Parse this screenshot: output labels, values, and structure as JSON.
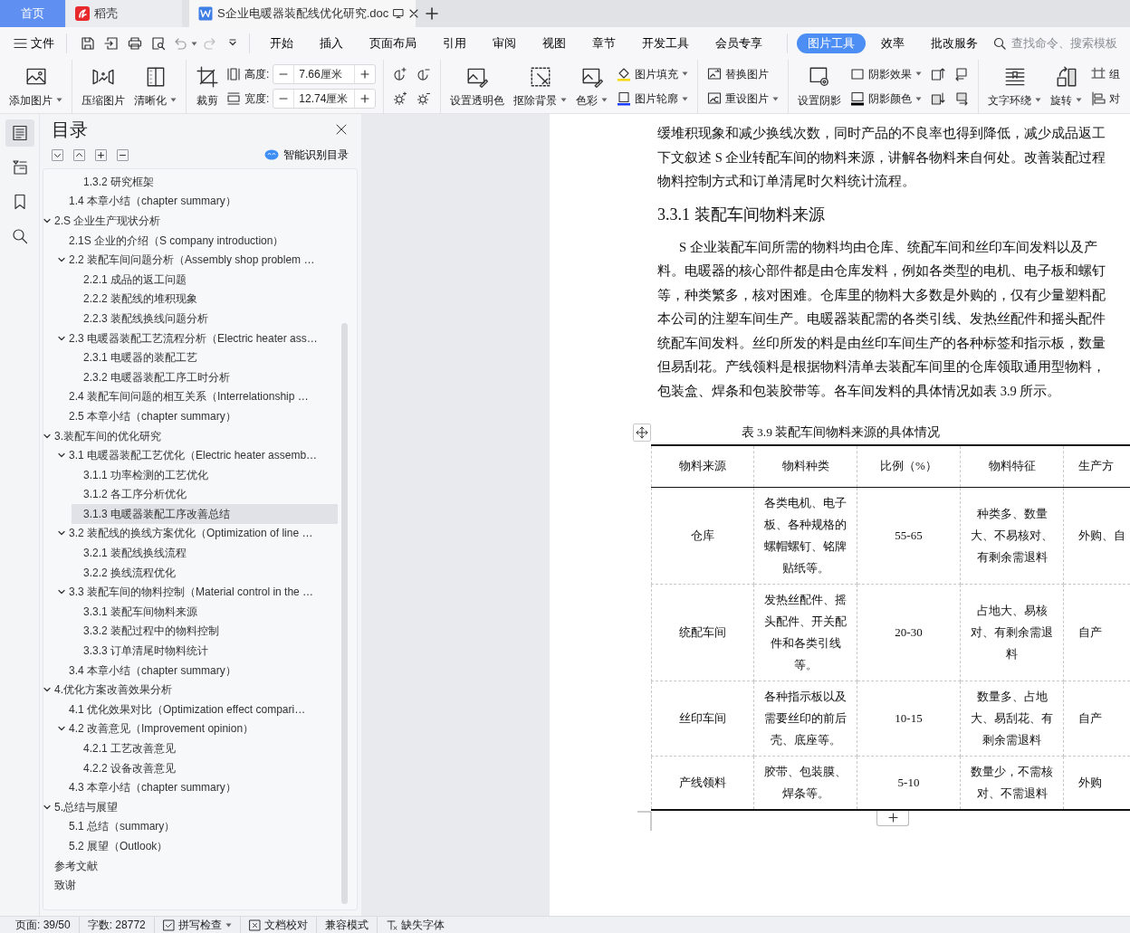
{
  "tabs": [
    {
      "label": "首页",
      "kind": "home",
      "selected": false
    },
    {
      "label": "稻壳",
      "kind": "app",
      "selected": false
    },
    {
      "label": "S企业电暖器装配线优化研究.doc",
      "kind": "document",
      "selected": true
    }
  ],
  "menu": {
    "file": "文件",
    "tabs": [
      {
        "label": "开始",
        "selected": false
      },
      {
        "label": "插入",
        "selected": false
      },
      {
        "label": "页面布局",
        "selected": false
      },
      {
        "label": "引用",
        "selected": false
      },
      {
        "label": "审阅",
        "selected": false
      },
      {
        "label": "视图",
        "selected": false
      },
      {
        "label": "章节",
        "selected": false
      },
      {
        "label": "开发工具",
        "selected": false
      },
      {
        "label": "会员专享",
        "selected": false
      },
      {
        "label": "图片工具",
        "selected": true
      },
      {
        "label": "效率",
        "selected": false
      },
      {
        "label": "批改服务",
        "selected": false
      }
    ],
    "search": {
      "placeholder": "查找命令、搜索模板"
    }
  },
  "ribbon": {
    "groups": [
      {
        "columns": [
          [
            {
              "kind": "large",
              "label": "添加图片",
              "dropdown": true
            }
          ]
        ]
      },
      {
        "columns": [
          [
            {
              "kind": "large",
              "label": "压缩图片",
              "dropdown": false
            }
          ],
          [
            {
              "kind": "large",
              "label": "清晰化",
              "dropdown": true
            }
          ]
        ]
      },
      {
        "columns": [
          [
            {
              "kind": "large",
              "label": "裁剪",
              "dropdown": false
            }
          ],
          [
            {
              "kind": "spin",
              "label": "高度:",
              "value": "7.66厘米"
            },
            {
              "kind": "spin",
              "label": "宽度:",
              "value": "12.74厘米"
            }
          ]
        ]
      },
      {
        "columns": [
          [
            {
              "kind": "icon"
            },
            {
              "kind": "icon"
            }
          ],
          [
            {
              "kind": "icon"
            },
            {
              "kind": "icon"
            }
          ]
        ]
      },
      {
        "columns": [
          [
            {
              "kind": "large",
              "label": "设置透明色",
              "dropdown": false
            }
          ],
          [
            {
              "kind": "large",
              "label": "抠除背景",
              "dropdown": true
            }
          ],
          [
            {
              "kind": "large",
              "label": "色彩",
              "dropdown": true
            }
          ],
          [
            {
              "kind": "small",
              "label": "图片填充",
              "dropdown": true
            },
            {
              "kind": "small",
              "label": "图片轮廓",
              "dropdown": true
            }
          ]
        ]
      },
      {
        "columns": [
          [
            {
              "kind": "small",
              "label": "替换图片",
              "dropdown": false
            },
            {
              "kind": "small",
              "label": "重设图片",
              "dropdown": true
            }
          ]
        ]
      },
      {
        "columns": [
          [
            {
              "kind": "large",
              "label": "设置阴影",
              "dropdown": false
            }
          ],
          [
            {
              "kind": "small",
              "label": "阴影效果",
              "dropdown": true
            },
            {
              "kind": "small",
              "label": "阴影颜色",
              "dropdown": true
            }
          ],
          [
            {
              "kind": "icon"
            },
            {
              "kind": "icon"
            }
          ],
          [
            {
              "kind": "icon"
            },
            {
              "kind": "icon"
            }
          ]
        ]
      },
      {
        "columns": [
          [
            {
              "kind": "large",
              "label": "文字环绕",
              "dropdown": true
            }
          ],
          [
            {
              "kind": "large",
              "label": "旋转",
              "dropdown": true
            }
          ],
          [
            {
              "kind": "small",
              "label": "组",
              "dropdown": false
            },
            {
              "kind": "small",
              "label": "对",
              "dropdown": false
            }
          ]
        ]
      }
    ]
  },
  "toc": {
    "title": "目录",
    "smart_button": "智能识别目录",
    "items": [
      {
        "children": [
          {
            "children": [
              {
                "label": "1.3.2 研究框架",
                "selected": false
              }
            ]
          },
          {
            "label": "1.4 本章小结（chapter summary）",
            "selected": false
          }
        ]
      },
      {
        "label": "2.S 企业生产现状分析",
        "expanded": true,
        "selected": false,
        "children": [
          {
            "label": "2.1S 企业的介绍（S company introduction）",
            "selected": false
          },
          {
            "label": "2.2 装配车间问题分析（Assembly shop problem …",
            "expanded": true,
            "selected": false,
            "children": [
              {
                "label": "2.2.1 成品的返工问题",
                "selected": false
              },
              {
                "label": "2.2.2 装配线的堆积现象",
                "selected": false
              },
              {
                "label": "2.2.3 装配线换线问题分析",
                "selected": false
              }
            ]
          },
          {
            "label": "2.3 电暖器装配工艺流程分析（Electric heater ass…",
            "expanded": true,
            "selected": false,
            "children": [
              {
                "label": "2.3.1 电暖器的装配工艺",
                "selected": false
              },
              {
                "label": "2.3.2 电暖器装配工序工时分析",
                "selected": false
              }
            ]
          },
          {
            "label": "2.4 装配车间问题的相互关系（Interrelationship …",
            "selected": false
          },
          {
            "label": "2.5 本章小结（chapter summary）",
            "selected": false
          }
        ]
      },
      {
        "label": "3.装配车间的优化研究",
        "expanded": true,
        "selected": false,
        "children": [
          {
            "label": "3.1 电暖器装配工艺优化（Electric heater assemb…",
            "expanded": true,
            "selected": false,
            "children": [
              {
                "label": "3.1.1 功率检测的工艺优化",
                "selected": false
              },
              {
                "label": "3.1.2 各工序分析优化",
                "selected": false
              },
              {
                "label": "3.1.3 电暖器装配工序改善总结",
                "selected": true
              }
            ]
          },
          {
            "label": "3.2 装配线的换线方案优化（Optimization of line …",
            "expanded": true,
            "selected": false,
            "children": [
              {
                "label": "3.2.1 装配线换线流程",
                "selected": false
              },
              {
                "label": "3.2.2 换线流程优化",
                "selected": false
              }
            ]
          },
          {
            "label": "3.3 装配车间的物料控制（Material control in the …",
            "expanded": true,
            "selected": false,
            "children": [
              {
                "label": "3.3.1 装配车间物料来源",
                "selected": false
              },
              {
                "label": "3.3.2 装配过程中的物料控制",
                "selected": false
              },
              {
                "label": "3.3.3 订单清尾时物料统计",
                "selected": false
              }
            ]
          },
          {
            "label": "3.4 本章小结（chapter summary）",
            "selected": false
          }
        ]
      },
      {
        "label": "4.优化方案改善效果分析",
        "expanded": true,
        "selected": false,
        "children": [
          {
            "label": "4.1 优化效果对比（Optimization effect compari…",
            "selected": false
          },
          {
            "label": "4.2 改善意见（Improvement opinion）",
            "expanded": true,
            "selected": false,
            "children": [
              {
                "label": "4.2.1 工艺改善意见",
                "selected": false
              },
              {
                "label": "4.2.2 设备改善意见",
                "selected": false
              }
            ]
          },
          {
            "label": "4.3 本章小结（chapter summary）",
            "selected": false
          }
        ]
      },
      {
        "label": "5.总结与展望",
        "expanded": true,
        "selected": false,
        "children": [
          {
            "label": "5.1 总结（summary）",
            "selected": false
          },
          {
            "label": "5.2 展望（Outlook）",
            "selected": false
          }
        ]
      },
      {
        "label": "参考文献",
        "selected": false
      },
      {
        "label": "致谢",
        "selected": false
      }
    ]
  },
  "document": {
    "blocks": [
      {
        "kind": "body",
        "indent": false,
        "lines": [
          "缓堆积现象和减少换线次数，同时产品的不良率也得到降低，减少成品返工",
          "下文叙述 S 企业转配车间的物料来源，讲解各物料来自何处。改善装配过程",
          "物料控制方式和订单清尾时欠料统计流程。"
        ]
      },
      {
        "kind": "heading",
        "text": "3.3.1 装配车间物料来源"
      },
      {
        "kind": "body",
        "indent": true,
        "lines": [
          "S 企业装配车间所需的物料均由仓库、统配车间和丝印车间发料以及产",
          "料。电暖器的核心部件都是由仓库发料，例如各类型的电机、电子板和螺钉",
          "等，种类繁多，核对困难。仓库里的物料大多数是外购的，仅有少量塑料配",
          "本公司的注塑车间生产。电暖器装配需的各类引线、发热丝配件和摇头配件",
          "统配车间发料。丝印所发的料是由丝印车间生产的各种标签和指示板，数量",
          "但易刮花。产线领料是根据物料清单去装配车间里的仓库领取通用型物料，",
          "包装盒、焊条和包装胶带等。各车间发料的具体情况如表 3.9 所示。"
        ]
      }
    ],
    "table": {
      "caption": "表 3.9 装配车间物料来源的具体情况",
      "columns": [
        "物料来源",
        "物料种类",
        "比例（%）",
        "物料特征",
        "生产方"
      ],
      "rows": [
        [
          "仓库",
          "各类电机、电子板、各种规格的螺帽螺钉、铭牌贴纸等。",
          "55-65",
          "种类多、数量大、不易核对、有剩余需退料",
          "外购、自"
        ],
        [
          "统配车间",
          "发热丝配件、摇头配件、开关配件和各类引线等。",
          "20-30",
          "占地大、易核对、有剩余需退料",
          "自产"
        ],
        [
          "丝印车间",
          "各种指示板以及需要丝印的前后壳、底座等。",
          "10-15",
          "数量多、占地大、易刮花、有剩余需退料",
          "自产"
        ],
        [
          "产线领料",
          "胶带、包装膜、焊条等。",
          "5-10",
          "数量少，不需核对、不需退料",
          "外购"
        ]
      ]
    }
  },
  "status_bar": [
    {
      "kind": "text",
      "label": "页面: 39/50"
    },
    {
      "kind": "text",
      "label": "字数: 28772"
    },
    {
      "kind": "check",
      "label": "拼写检查",
      "dropdown": true
    },
    {
      "kind": "proof",
      "label": "文档校对"
    },
    {
      "kind": "text",
      "label": "兼容模式"
    },
    {
      "kind": "font",
      "label": "缺失字体"
    }
  ]
}
